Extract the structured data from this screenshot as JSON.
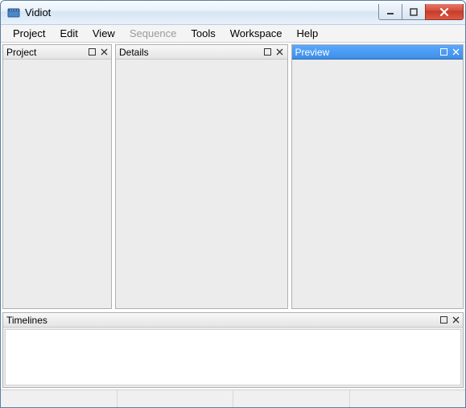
{
  "window": {
    "title": "Vidiot"
  },
  "menu": {
    "items": [
      {
        "label": "Project",
        "enabled": true
      },
      {
        "label": "Edit",
        "enabled": true
      },
      {
        "label": "View",
        "enabled": true
      },
      {
        "label": "Sequence",
        "enabled": false
      },
      {
        "label": "Tools",
        "enabled": true
      },
      {
        "label": "Workspace",
        "enabled": true
      },
      {
        "label": "Help",
        "enabled": true
      }
    ]
  },
  "panels": {
    "project": {
      "title": "Project",
      "active": false
    },
    "details": {
      "title": "Details",
      "active": false
    },
    "preview": {
      "title": "Preview",
      "active": true
    },
    "timelines": {
      "title": "Timelines",
      "active": false
    }
  }
}
